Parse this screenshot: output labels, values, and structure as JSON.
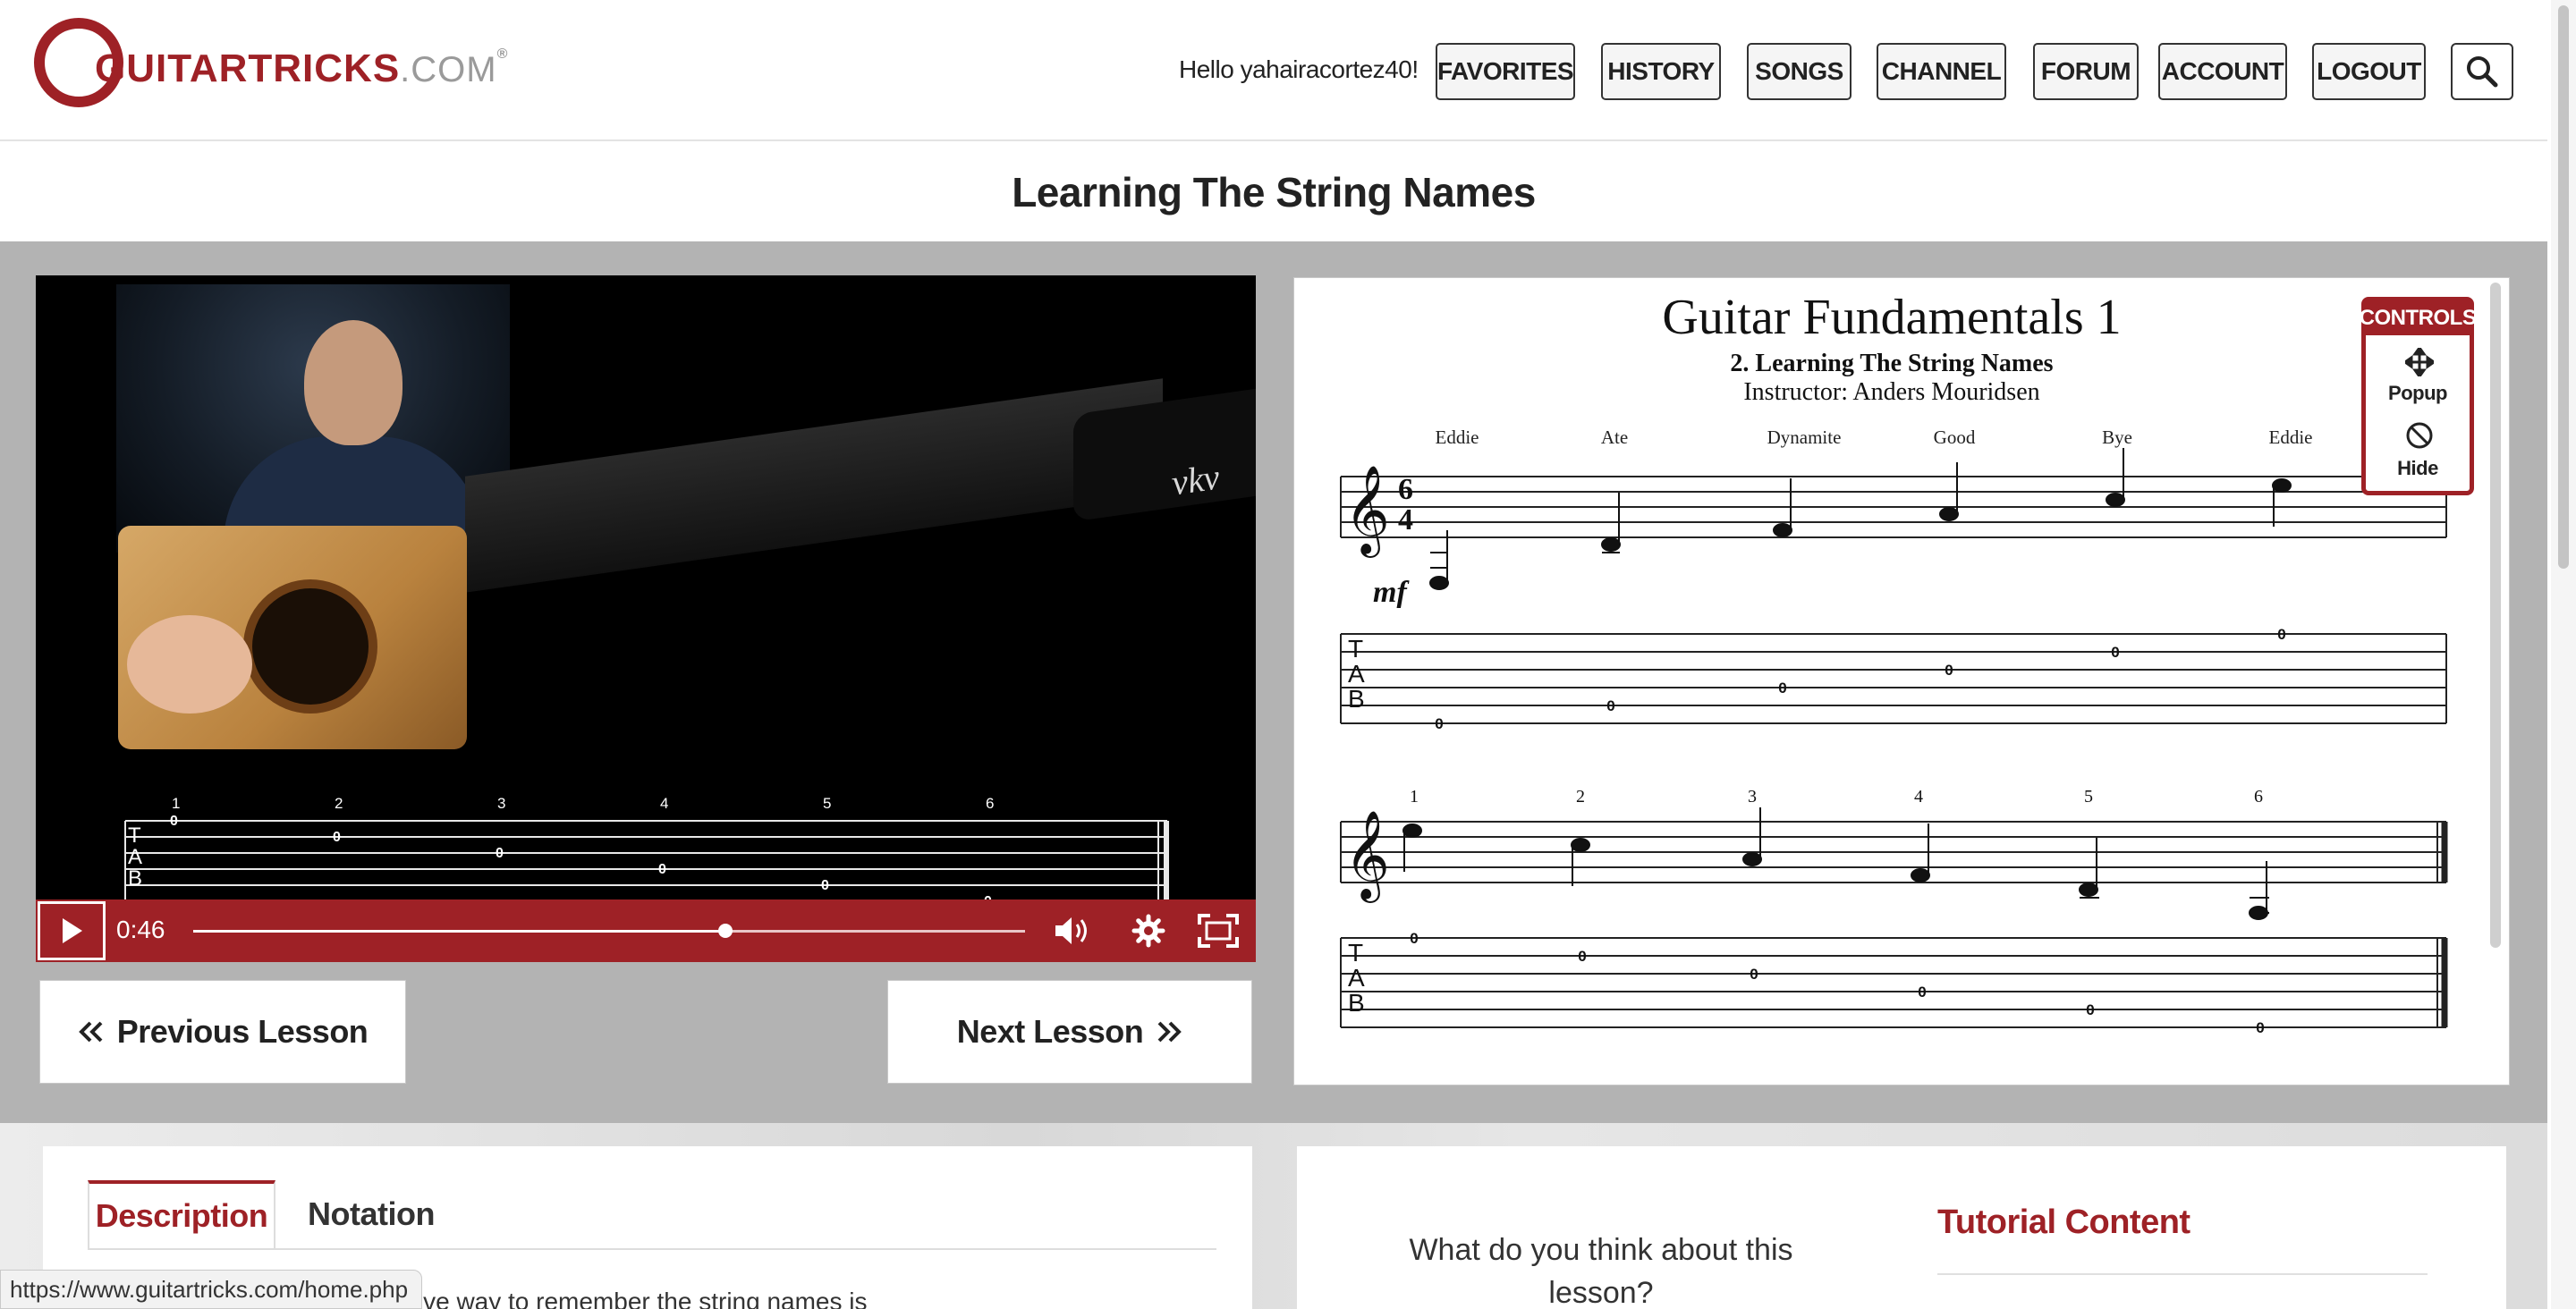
{
  "header": {
    "logo_text": "GUITARTRICKS",
    "logo_suffix": ".COM",
    "logo_reg": "®",
    "greeting": "Hello yahairacortez40!",
    "nav": [
      "FAVORITES",
      "HISTORY",
      "SONGS",
      "CHANNEL",
      "FORUM",
      "ACCOUNT",
      "LOGOUT"
    ],
    "search_icon": "search-icon"
  },
  "page": {
    "title": "Learning The String Names"
  },
  "video": {
    "brand": "vkv",
    "time": "0:46",
    "progress": 0.64,
    "icons": [
      "play-icon",
      "volume-icon",
      "gear-icon",
      "fullscreen-icon"
    ],
    "tab_numbers": [
      "1",
      "2",
      "3",
      "4",
      "5",
      "6"
    ],
    "tab_letters": [
      "T",
      "A",
      "B"
    ],
    "tab_frets": [
      "0",
      "0",
      "0",
      "0",
      "0",
      "0"
    ]
  },
  "lesson_nav": {
    "previous": "Previous Lesson",
    "next": "Next Lesson"
  },
  "notation": {
    "title": "Guitar Fundamentals 1",
    "subtitle": "2. Learning The String Names",
    "instructor": "Instructor: Anders Mouridsen",
    "lyrics": [
      "Eddie",
      "Ate",
      "Dynamite",
      "Good",
      "Bye",
      "Eddie"
    ],
    "time_signature": [
      "6",
      "4"
    ],
    "dynamic": "mf",
    "tab_letters": [
      "T",
      "A",
      "B"
    ],
    "system2_numbers": [
      "1",
      "2",
      "3",
      "4",
      "5",
      "6"
    ],
    "frets": [
      "0",
      "0",
      "0",
      "0",
      "0",
      "0"
    ]
  },
  "controls": {
    "title": "CONTROLS",
    "popup": "Popup",
    "hide": "Hide"
  },
  "tabs": {
    "description": "Description",
    "notation": "Notation"
  },
  "description_text": "ng names. The silly, but effective way to remember the string names is",
  "rating": {
    "question": "What do you think about this lesson?"
  },
  "tutorial": {
    "title": "Tutorial Content"
  },
  "status_url": "https://www.guitartricks.com/home.php",
  "colors": {
    "brand": "#9e2126",
    "grey_area": "#b3b3b3"
  }
}
